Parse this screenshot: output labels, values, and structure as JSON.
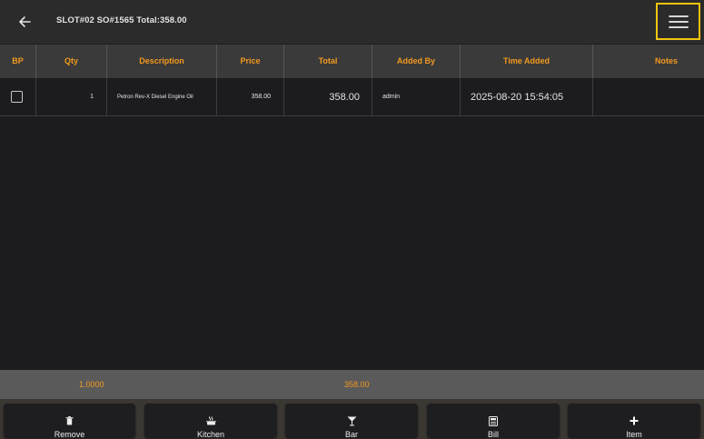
{
  "header": {
    "title": "SLOT#02 SO#1565 Total:358.00",
    "back_icon": "arrow-left-icon",
    "menu_icon": "hamburger-menu-icon",
    "menu_highlight_color": "#f1c40f"
  },
  "table": {
    "header_color": "#f39a1e",
    "columns": [
      "BP",
      "Qty",
      "Description",
      "Price",
      "Total",
      "Added By",
      "Time Added",
      "Notes"
    ],
    "rows": [
      {
        "bp_checked": false,
        "qty": "1",
        "description": "Petron Rev-X Diesel Engine Oil",
        "price": "358.00",
        "total": "358.00",
        "added_by": "admin",
        "time_added": "2025-08-20 15:54:05",
        "notes": ""
      }
    ]
  },
  "totals": {
    "qty": "1.0000",
    "total": "358.00"
  },
  "actions": [
    {
      "label": "Remove",
      "icon": "trash-icon"
    },
    {
      "label": "Kitchen",
      "icon": "cooking-pot-icon"
    },
    {
      "label": "Bar",
      "icon": "cocktail-glass-icon"
    },
    {
      "label": "Bill",
      "icon": "receipt-icon"
    },
    {
      "label": "Item",
      "icon": "plus-icon"
    }
  ]
}
